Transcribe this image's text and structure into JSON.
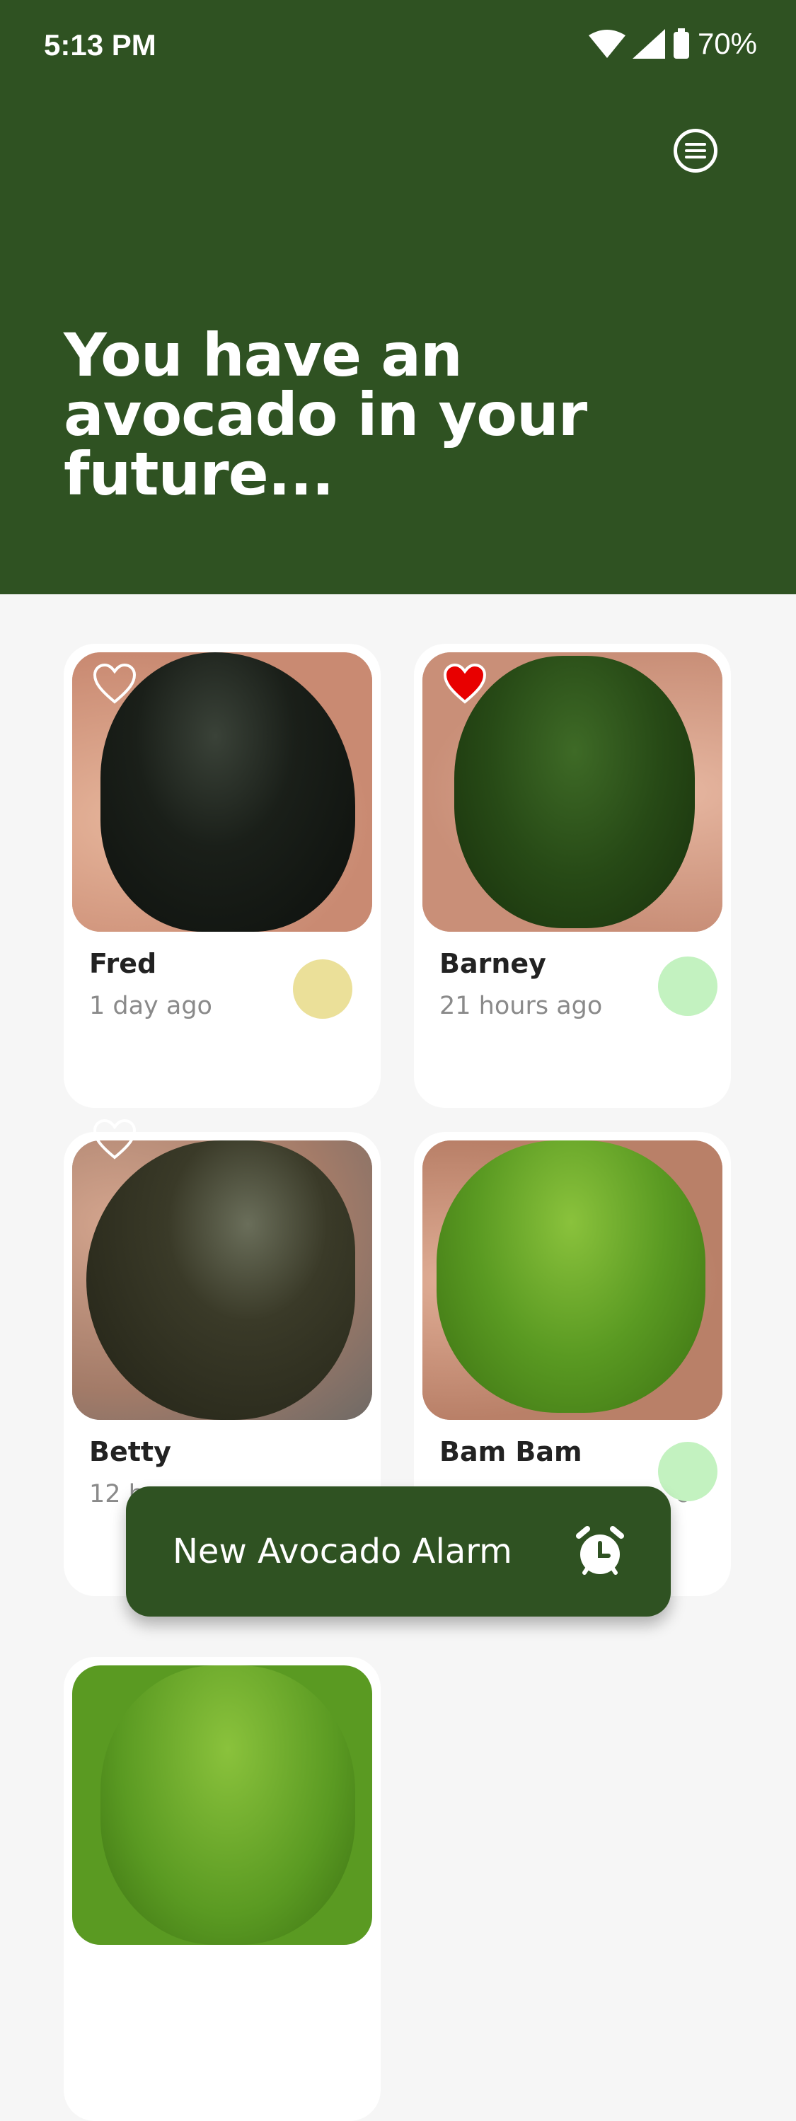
{
  "status_bar": {
    "time": "5:13 PM",
    "battery": "70%",
    "icons": [
      "wifi-icon",
      "signal-icon",
      "battery-icon"
    ]
  },
  "header": {
    "title": "You have an avocado in your future...",
    "menu_icon": "menu-icon",
    "background_color": "#2f5222"
  },
  "avocados": [
    {
      "name": "Fred",
      "time_ago": "1 day ago",
      "favorite": false,
      "ripeness_color": "#ebe099",
      "skin_color": "#151a14"
    },
    {
      "name": "Barney",
      "time_ago": "21 hours ago",
      "favorite": true,
      "ripeness_color": "#c3f2c0",
      "skin_color": "#223a14"
    },
    {
      "name": "Betty",
      "time_ago": "12 h",
      "favorite": false,
      "ripeness_color": "",
      "skin_color": "#2a2a1c"
    },
    {
      "name": "Bam Bam",
      "time_ago": "o",
      "favorite": false,
      "ripeness_color": "#c3f2c0",
      "skin_color": "#5a9a22"
    }
  ],
  "fab": {
    "label": "New Avocado Alarm",
    "icon": "alarm-clock-icon"
  },
  "colors": {
    "favorite_active": "#e80000",
    "favorite_inactive": "#ffffff",
    "card_background": "#ffffff",
    "page_background": "#f6f6f6"
  }
}
